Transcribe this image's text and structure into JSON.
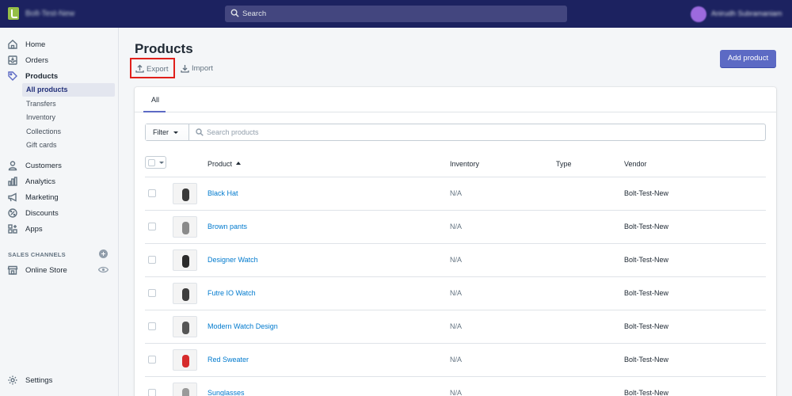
{
  "topbar": {
    "store_name": "Bolt-Test-New",
    "search_placeholder": "Search",
    "user_name": "Anirudh Subramaniam"
  },
  "sidebar": {
    "items": [
      {
        "label": "Home",
        "icon": "home-icon"
      },
      {
        "label": "Orders",
        "icon": "orders-icon"
      },
      {
        "label": "Products",
        "icon": "tag-icon",
        "active": true
      },
      {
        "label": "Customers",
        "icon": "person-icon"
      },
      {
        "label": "Analytics",
        "icon": "bar-chart-icon"
      },
      {
        "label": "Marketing",
        "icon": "megaphone-icon"
      },
      {
        "label": "Discounts",
        "icon": "discount-icon"
      },
      {
        "label": "Apps",
        "icon": "apps-icon"
      }
    ],
    "product_subitems": [
      {
        "label": "All products",
        "active": true
      },
      {
        "label": "Transfers"
      },
      {
        "label": "Inventory"
      },
      {
        "label": "Collections"
      },
      {
        "label": "Gift cards"
      }
    ],
    "sales_channels_title": "SALES CHANNELS",
    "online_store": "Online Store",
    "settings": "Settings"
  },
  "page": {
    "title": "Products",
    "export_label": "Export",
    "import_label": "Import",
    "add_product_label": "Add product"
  },
  "tabs": [
    {
      "label": "All"
    }
  ],
  "filter": {
    "label": "Filter",
    "search_placeholder": "Search products"
  },
  "table": {
    "columns": {
      "product": "Product",
      "inventory": "Inventory",
      "type": "Type",
      "vendor": "Vendor"
    },
    "rows": [
      {
        "name": "Black Hat",
        "inventory": "N/A",
        "type": "",
        "vendor": "Bolt-Test-New",
        "thumb_color": "#3a3a3a"
      },
      {
        "name": "Brown pants",
        "inventory": "N/A",
        "type": "",
        "vendor": "Bolt-Test-New",
        "thumb_color": "#8a8a8a"
      },
      {
        "name": "Designer Watch",
        "inventory": "N/A",
        "type": "",
        "vendor": "Bolt-Test-New",
        "thumb_color": "#2b2b2b"
      },
      {
        "name": "Futre IO Watch",
        "inventory": "N/A",
        "type": "",
        "vendor": "Bolt-Test-New",
        "thumb_color": "#3d3d3d"
      },
      {
        "name": "Modern Watch Design",
        "inventory": "N/A",
        "type": "",
        "vendor": "Bolt-Test-New",
        "thumb_color": "#555555"
      },
      {
        "name": "Red Sweater",
        "inventory": "N/A",
        "type": "",
        "vendor": "Bolt-Test-New",
        "thumb_color": "#d62b2b"
      },
      {
        "name": "Sunglasses",
        "inventory": "N/A",
        "type": "",
        "vendor": "Bolt-Test-New",
        "thumb_color": "#9a9a9a"
      }
    ]
  },
  "colors": {
    "topbar": "#1c2260",
    "accent": "#5c6ac4",
    "link": "#007ace",
    "highlight_box": "#e0201b"
  }
}
